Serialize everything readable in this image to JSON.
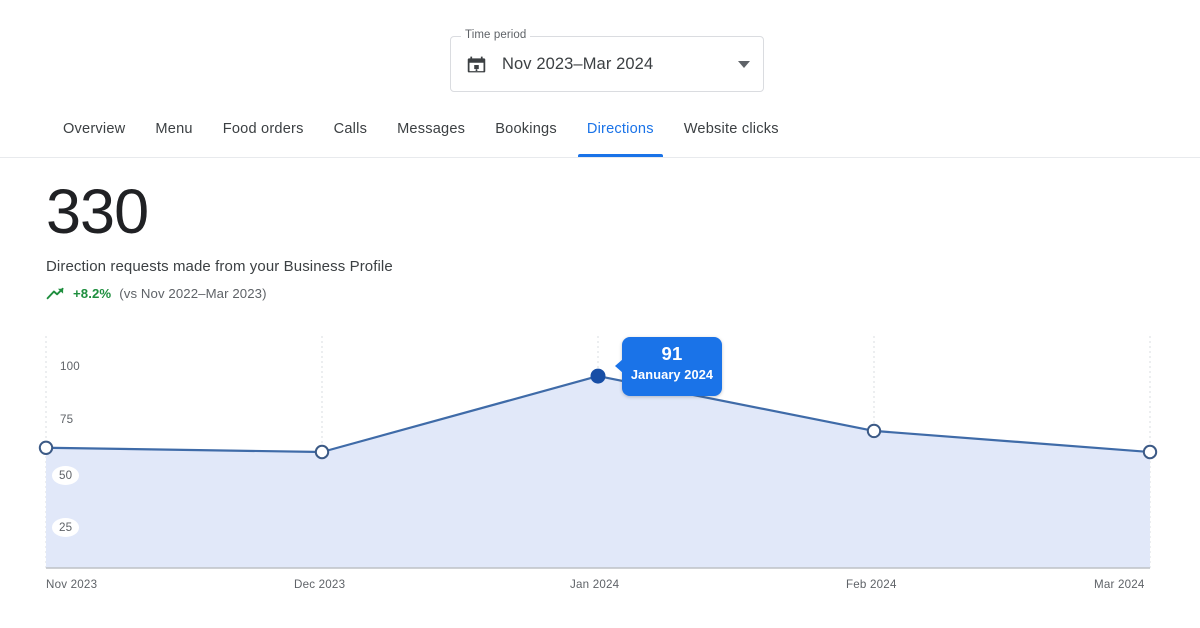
{
  "time_period": {
    "legend": "Time period",
    "value": "Nov 2023–Mar 2024",
    "calendar_icon": "calendar-icon",
    "dropdown_icon": "chevron-down-icon"
  },
  "tabs": [
    {
      "label": "Overview",
      "active": false
    },
    {
      "label": "Menu",
      "active": false
    },
    {
      "label": "Food orders",
      "active": false
    },
    {
      "label": "Calls",
      "active": false
    },
    {
      "label": "Messages",
      "active": false
    },
    {
      "label": "Bookings",
      "active": false
    },
    {
      "label": "Directions",
      "active": true
    },
    {
      "label": "Website clicks",
      "active": false
    }
  ],
  "metric": {
    "value": "330",
    "description": "Direction requests made from your Business Profile",
    "delta_pct": "+8.2%",
    "delta_comparison": "(vs Nov 2022–Mar 2023)",
    "trend_icon": "trending-up-icon",
    "delta_color": "#1e8e3e"
  },
  "tooltip": {
    "value": "91",
    "label": "January 2024",
    "bg_color": "#1a73e8"
  },
  "colors": {
    "accent": "#1a73e8",
    "line": "#3f6ba8",
    "area_fill": "#e1e8f9",
    "grid": "#dadce0",
    "text_primary": "#202124",
    "text_secondary": "#5f6368"
  },
  "chart_data": {
    "type": "line",
    "title": "Direction requests made from your Business Profile",
    "xlabel": "",
    "ylabel": "",
    "categories": [
      "Nov 2023",
      "Dec 2023",
      "Jan 2024",
      "Feb 2024",
      "Mar 2024"
    ],
    "values": [
      57,
      55,
      91,
      65,
      55
    ],
    "ylim": [
      0,
      110
    ],
    "yticks": [
      25,
      50,
      75,
      100
    ],
    "ytick_labels": [
      "25",
      "50",
      "75",
      "100"
    ],
    "grid": true,
    "grid_style": "dotted-vertical",
    "legend": "none",
    "highlighted_point": {
      "category": "Jan 2024",
      "value": 91
    },
    "total": 330,
    "series": [
      {
        "name": "Direction requests",
        "values": [
          57,
          55,
          91,
          65,
          55
        ]
      }
    ]
  }
}
